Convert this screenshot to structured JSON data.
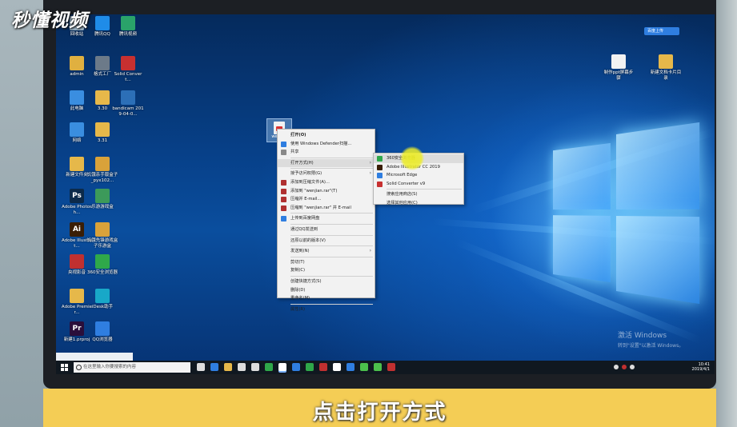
{
  "brand": {
    "logo_text": "秒懂视频"
  },
  "caption": "点击打开方式",
  "top_badge": "百度上传",
  "desktop_icons": [
    {
      "label": "回收站",
      "glyph": "",
      "color": "#9db6c8"
    },
    {
      "label": "腾讯QQ",
      "glyph": "",
      "color": "#1f8ce8"
    },
    {
      "label": "腾讯视频",
      "glyph": "",
      "color": "#2aa36a"
    },
    {
      "label": "admin",
      "glyph": "",
      "color": "#e0b040"
    },
    {
      "label": "格式工厂",
      "glyph": "",
      "color": "#6c7a89"
    },
    {
      "label": "Solid Convert...",
      "glyph": "",
      "color": "#c73030"
    },
    {
      "label": "此电脑",
      "glyph": "",
      "color": "#3a8ee0"
    },
    {
      "label": "3.30",
      "glyph": "",
      "color": "#e6b84a"
    },
    {
      "label": "bandicam 2019-04-0...",
      "glyph": "",
      "color": "#2c6fb7"
    },
    {
      "label": "网络",
      "glyph": "",
      "color": "#3a8ee0"
    },
    {
      "label": "3.31",
      "glyph": "",
      "color": "#e6b84a"
    },
    {
      "label": "新建文件夹",
      "glyph": "",
      "color": "#e6b84a"
    },
    {
      "label": "饥饿杀手版盒子_pyx102...",
      "glyph": "",
      "color": "#d9a23a"
    },
    {
      "label": "Adobe Photosh...",
      "glyph": "Ps",
      "color": "#0c2a4a"
    },
    {
      "label": "乐游游戏盒",
      "glyph": "",
      "color": "#3c9a5a"
    },
    {
      "label": "Adobe Illustrat...",
      "glyph": "Ai",
      "color": "#3a1e05"
    },
    {
      "label": "饥饿先锋游戏盒子乐游盒",
      "glyph": "",
      "color": "#d9a23a"
    },
    {
      "label": "央视影音",
      "glyph": "",
      "color": "#c03030"
    },
    {
      "label": "360安全浏览器",
      "glyph": "",
      "color": "#2fa84a"
    },
    {
      "label": "Adobe Premier...",
      "glyph": "",
      "color": "#e6b84a"
    },
    {
      "label": "iDesk助手",
      "glyph": "",
      "color": "#18a8c8"
    },
    {
      "label": "新建1.prproj",
      "glyph": "Pr",
      "color": "#2a0e3a"
    },
    {
      "label": "QQ浏览器",
      "glyph": "",
      "color": "#2f7ee0"
    }
  ],
  "right_icons": [
    {
      "label": "制作ppt屏幕步骤",
      "color": "#f2f2f2"
    },
    {
      "label": "新建文档卡片目录",
      "color": "#e6b84a"
    }
  ],
  "file": {
    "label": "wenjian"
  },
  "context_menu": {
    "items": [
      {
        "label": "打开(O)",
        "bold": true,
        "icon": "",
        "arrow": false,
        "highlight": false,
        "sep_after": false
      },
      {
        "label": "使用 Windows Defender扫描...",
        "icon": "#2f7ee0",
        "arrow": false,
        "highlight": false,
        "sep_after": false
      },
      {
        "label": "共享",
        "icon": "#8a8a8a",
        "arrow": false,
        "highlight": false,
        "sep_after": true
      },
      {
        "label": "打开方式(H)",
        "icon": "",
        "arrow": true,
        "highlight": true,
        "sep_after": true
      },
      {
        "label": "授予访问权限(G)",
        "icon": "",
        "arrow": true,
        "highlight": false,
        "sep_after": false
      },
      {
        "label": "添加到压缩文件(A)...",
        "icon": "#b03030",
        "arrow": false,
        "highlight": false,
        "sep_after": false
      },
      {
        "label": "添加到 \"wenjian.rar\"(T)",
        "icon": "#b03030",
        "arrow": false,
        "highlight": false,
        "sep_after": false
      },
      {
        "label": "压缩并 E-mail...",
        "icon": "#b03030",
        "arrow": false,
        "highlight": false,
        "sep_after": false
      },
      {
        "label": "压缩到 \"wenjian.rar\" 并 E-mail",
        "icon": "#b03030",
        "arrow": false,
        "highlight": false,
        "sep_after": true
      },
      {
        "label": "上传到百度网盘",
        "icon": "#2f7ee0",
        "arrow": false,
        "highlight": false,
        "sep_after": true
      },
      {
        "label": "通过QQ发送到",
        "icon": "",
        "arrow": false,
        "highlight": false,
        "sep_after": true
      },
      {
        "label": "还原以前的版本(V)",
        "icon": "",
        "arrow": false,
        "highlight": false,
        "sep_after": true
      },
      {
        "label": "发送到(N)",
        "icon": "",
        "arrow": true,
        "highlight": false,
        "sep_after": true
      },
      {
        "label": "剪切(T)",
        "icon": "",
        "arrow": false,
        "highlight": false,
        "sep_after": false
      },
      {
        "label": "复制(C)",
        "icon": "",
        "arrow": false,
        "highlight": false,
        "sep_after": true
      },
      {
        "label": "创建快捷方式(S)",
        "icon": "",
        "arrow": false,
        "highlight": false,
        "sep_after": false
      },
      {
        "label": "删除(D)",
        "icon": "",
        "arrow": false,
        "highlight": false,
        "sep_after": false
      },
      {
        "label": "重命名(M)",
        "icon": "",
        "arrow": false,
        "highlight": false,
        "sep_after": true
      },
      {
        "label": "属性(R)",
        "icon": "",
        "arrow": false,
        "highlight": false,
        "sep_after": false
      }
    ]
  },
  "open_with_menu": {
    "items": [
      {
        "label": "360安全浏览器",
        "icon": "#2fa84a",
        "highlight": true,
        "sep_after": false
      },
      {
        "label": "Adobe Illustrator CC 2019",
        "icon": "#3a1e05",
        "highlight": false,
        "sep_after": false
      },
      {
        "label": "Microsoft Edge",
        "icon": "#2f7ee0",
        "highlight": false,
        "sep_after": false
      },
      {
        "label": "Solid Converter v9",
        "icon": "#c73030",
        "highlight": false,
        "sep_after": true
      },
      {
        "label": "搜索应用商店(S)",
        "icon": "",
        "highlight": false,
        "sep_after": false
      },
      {
        "label": "选择其他应用(C)",
        "icon": "",
        "highlight": false,
        "sep_after": false
      }
    ]
  },
  "watermark": {
    "line1": "激活 Windows",
    "line2": "转到\"设置\"以激活 Windows。"
  },
  "taskbar": {
    "search_placeholder": "在这里输入你要搜索的内容",
    "apps": [
      "#dddddd",
      "#2f7ee0",
      "#e6b84a",
      "#dddddd",
      "#dddddd",
      "#2fa84a",
      "#ffffff",
      "#2f7ee0",
      "#2fa84a",
      "#c03030",
      "#ffffff",
      "#2f7ee0",
      "#4cc04c",
      "#4cc04c",
      "#c03030"
    ],
    "time": "10:41",
    "date": "2019/4/1"
  }
}
